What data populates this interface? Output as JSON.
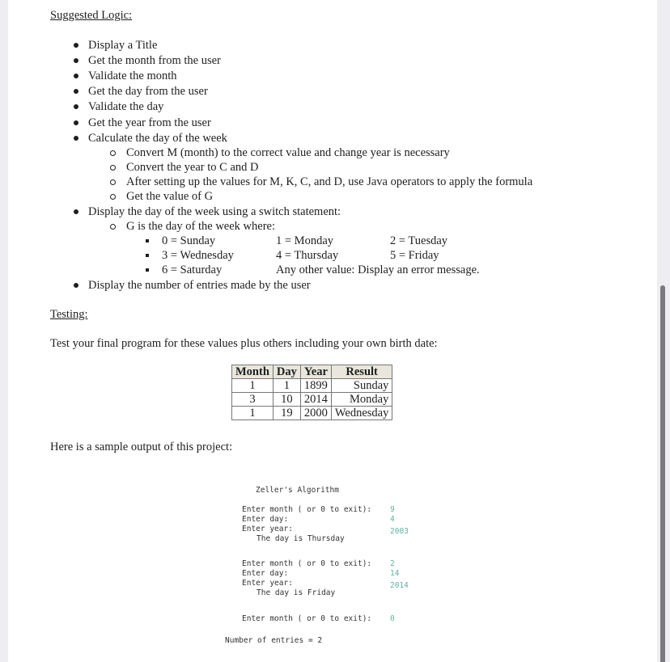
{
  "logic": {
    "heading": "Suggested Logic:",
    "items": [
      "Display a Title",
      "Get the month from the user",
      "Validate the month",
      "Get the day from the user",
      "Validate the day",
      "Get the year from the user",
      "Calculate the day of the week"
    ],
    "calc_subitems": [
      "Convert M (month) to the correct value and change year is necessary",
      "Convert the year to C and D",
      "After setting up the values for M, K, C, and D, use Java operators to apply the formula",
      "Get the value of G"
    ],
    "switch_item": "Display the day of the week using a switch statement:",
    "switch_sub": "G is the day of the week where:",
    "day_map": [
      [
        "0 = Sunday",
        "1 = Monday",
        "2 = Tuesday"
      ],
      [
        "3 = Wednesday",
        "4 = Thursday",
        "5 = Friday"
      ],
      [
        "6 = Saturday",
        "Any other value: Display an error message.",
        ""
      ]
    ],
    "last_item": "Display the number of entries made by the user"
  },
  "testing": {
    "heading": "Testing:",
    "intro": "Test your final program for these values plus others including your own birth date:",
    "table": {
      "headers": [
        "Month",
        "Day",
        "Year",
        "Result"
      ],
      "rows": [
        [
          "1",
          "1",
          "1899",
          "Sunday"
        ],
        [
          "3",
          "10",
          "2014",
          "Monday"
        ],
        [
          "1",
          "19",
          "2000",
          "Wednesday"
        ]
      ]
    }
  },
  "sample": {
    "intro": "Here is a sample output of this project:",
    "title": "Zeller's Algorithm",
    "prompt_month": "Enter month ( or 0 to exit):",
    "prompt_day": "Enter day:",
    "prompt_year": "Enter year:",
    "runs": [
      {
        "month": "9",
        "day": "4",
        "year": "2003",
        "result": "The day is Thursday"
      },
      {
        "month": "2",
        "day": "14",
        "year": "2014",
        "result": "The day is Friday"
      }
    ],
    "exit_value": "0",
    "entries": "Number of entries = 2"
  }
}
